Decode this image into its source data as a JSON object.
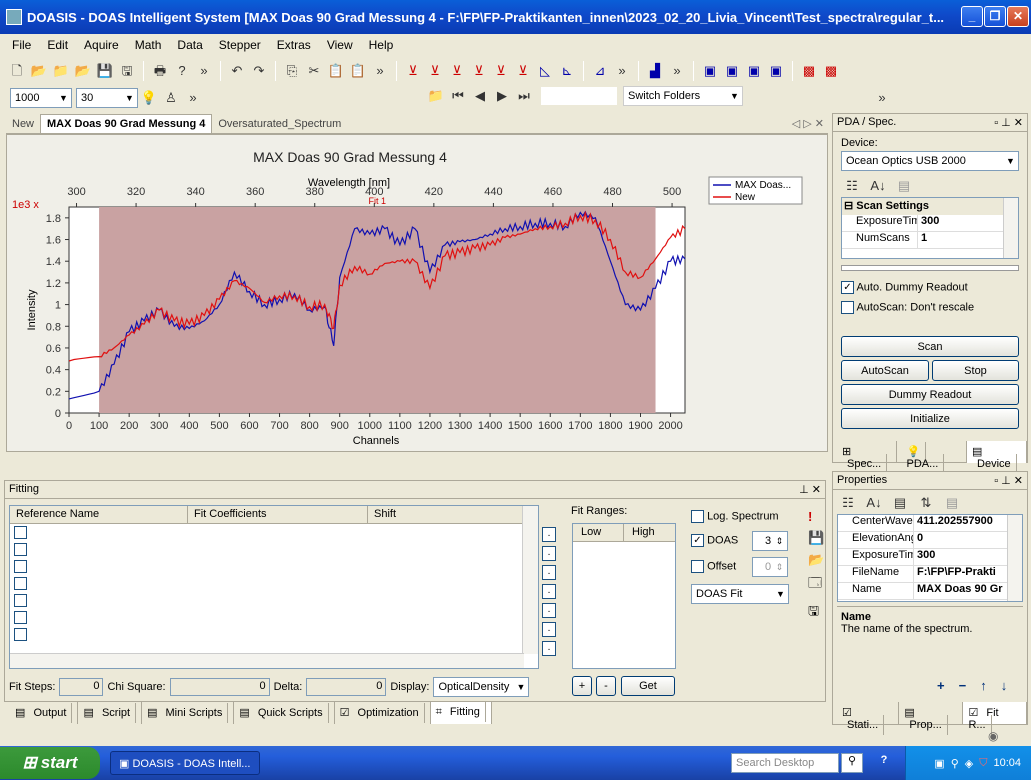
{
  "window": {
    "title": "DOASIS - DOAS Intelligent System [MAX Doas 90 Grad Messung 4 - F:\\FP\\FP-Praktikanten_innen\\2023_02_20_Livia_Vincent\\Test_spectra\\regular_t..."
  },
  "menu": [
    "File",
    "Edit",
    "Aquire",
    "Math",
    "Data",
    "Stepper",
    "Extras",
    "View",
    "Help"
  ],
  "toolbar2": {
    "value1": "1000",
    "value2": "30",
    "switch_folders": "Switch Folders"
  },
  "doc_tabs": [
    {
      "label": "New"
    },
    {
      "label": "MAX Doas 90 Grad Messung 4"
    },
    {
      "label": "Oversaturated_Spectrum"
    }
  ],
  "chart": {
    "title": "MAX Doas 90 Grad Messung 4",
    "xlabel_top": "Wavelength [nm]",
    "fit_label": "Fit 1",
    "scale_label": "1e3 x",
    "ylabel": "Intensity",
    "xlabel": "Channels"
  },
  "chart_data": {
    "type": "line",
    "title": "MAX Doas 90 Grad Messung 4",
    "xlabel": "Channels",
    "x2label": "Wavelength [nm]",
    "ylabel": "Intensity",
    "xlim": [
      0,
      2048
    ],
    "ylim": [
      0,
      1.9
    ],
    "y_scale_note": "1e3 x",
    "x_ticks": [
      0,
      100,
      200,
      300,
      400,
      500,
      600,
      700,
      800,
      900,
      1000,
      1100,
      1200,
      1300,
      1400,
      1500,
      1600,
      1700,
      1800,
      1900,
      2000
    ],
    "x2_ticks": [
      300,
      320,
      340,
      360,
      380,
      400,
      420,
      440,
      460,
      480,
      500
    ],
    "y_ticks": [
      0,
      0.2,
      0.4,
      0.6,
      0.8,
      1,
      1.2,
      1.4,
      1.6,
      1.8
    ],
    "fit_range": [
      100,
      1950
    ],
    "legend": [
      "MAX Doas...",
      "New"
    ],
    "series": [
      {
        "name": "MAX Doas...",
        "color": "#1010b0",
        "x": [
          0,
          100,
          150,
          200,
          250,
          300,
          350,
          400,
          450,
          500,
          550,
          600,
          650,
          700,
          750,
          800,
          850,
          880,
          900,
          950,
          1000,
          1050,
          1100,
          1150,
          1200,
          1250,
          1300,
          1350,
          1400,
          1450,
          1500,
          1550,
          1600,
          1650,
          1700,
          1750,
          1800,
          1850,
          1900,
          1950,
          2000,
          2048
        ],
        "y": [
          0.13,
          0.2,
          0.45,
          0.75,
          0.85,
          0.95,
          0.8,
          0.78,
          0.85,
          1.0,
          1.3,
          1.12,
          1.0,
          1.05,
          1.1,
          0.95,
          0.98,
          0.62,
          1.25,
          1.7,
          1.65,
          1.7,
          1.55,
          1.7,
          1.3,
          1.55,
          1.58,
          1.6,
          1.65,
          1.7,
          1.72,
          1.75,
          1.75,
          1.72,
          1.85,
          1.8,
          1.4,
          1.0,
          0.95,
          1.15,
          1.4,
          1.42
        ]
      },
      {
        "name": "New",
        "color": "#e01010",
        "x": [
          0,
          100,
          150,
          200,
          250,
          300,
          350,
          400,
          450,
          500,
          550,
          600,
          650,
          700,
          750,
          800,
          850,
          880,
          900,
          950,
          1000,
          1050,
          1100,
          1150,
          1200,
          1250,
          1300,
          1350,
          1400,
          1450,
          1500,
          1550,
          1600,
          1650,
          1700,
          1750,
          1800,
          1850,
          1900,
          1950,
          2000,
          2048
        ],
        "y": [
          0.48,
          0.52,
          0.6,
          0.72,
          0.82,
          0.95,
          0.85,
          0.82,
          0.9,
          1.05,
          1.22,
          1.15,
          1.02,
          1.08,
          1.08,
          0.98,
          1.0,
          0.78,
          1.18,
          1.35,
          1.28,
          1.38,
          1.4,
          1.4,
          1.15,
          1.45,
          1.48,
          1.52,
          1.55,
          1.62,
          1.65,
          1.7,
          1.72,
          1.75,
          1.82,
          1.78,
          1.6,
          1.3,
          1.25,
          1.42,
          1.62,
          1.7
        ]
      }
    ]
  },
  "fitting": {
    "title": "Fitting",
    "columns": [
      "Reference Name",
      "Fit Coefficients",
      "Shift"
    ],
    "fit_ranges_label": "Fit Ranges:",
    "range_cols": [
      "Low",
      "High"
    ],
    "log_spectrum": "Log. Spectrum",
    "doas": "DOAS",
    "doas_value": "3",
    "offset": "Offset",
    "offset_value": "0",
    "mode": "DOAS Fit",
    "fit_steps_label": "Fit Steps:",
    "fit_steps": "0",
    "chi_label": "Chi Square:",
    "chi": "0",
    "delta_label": "Delta:",
    "delta": "0",
    "display_label": "Display:",
    "display": "OpticalDensity",
    "plus": "+",
    "minus": "-",
    "get": "Get"
  },
  "bottom_tabs": [
    "Output",
    "Script",
    "Mini Scripts",
    "Quick Scripts",
    "Optimization",
    "Fitting"
  ],
  "pda": {
    "title": "PDA / Spec.",
    "device_label": "Device:",
    "device": "Ocean Optics USB 2000",
    "section": "Scan Settings",
    "props": [
      {
        "k": "ExposureTim",
        "v": "300"
      },
      {
        "k": "NumScans",
        "v": "1"
      }
    ],
    "auto_dummy": "Auto. Dummy Readout",
    "autoscan_norescale": "AutoScan: Don't rescale",
    "scan": "Scan",
    "autoscan": "AutoScan",
    "stop": "Stop",
    "dummy": "Dummy Readout",
    "initialize": "Initialize",
    "tabs": [
      "Spec...",
      "PDA...",
      "Device"
    ]
  },
  "properties": {
    "title": "Properties",
    "rows": [
      {
        "k": "CenterWaveler",
        "v": "411.202557900"
      },
      {
        "k": "ElevationAngle",
        "v": "0"
      },
      {
        "k": "ExposureTime",
        "v": "300"
      },
      {
        "k": "FileName",
        "v": "F:\\FP\\FP-Prakti"
      },
      {
        "k": "Name",
        "v": "MAX Doas 90 Gr"
      }
    ],
    "desc_title": "Name",
    "desc": "The name of the spectrum.",
    "tabs": [
      "Stati...",
      "Prop...",
      "Fit R..."
    ]
  },
  "taskbar": {
    "start": "start",
    "app": "DOASIS - DOAS Intell...",
    "search": "Search Desktop",
    "time": "10:04"
  }
}
